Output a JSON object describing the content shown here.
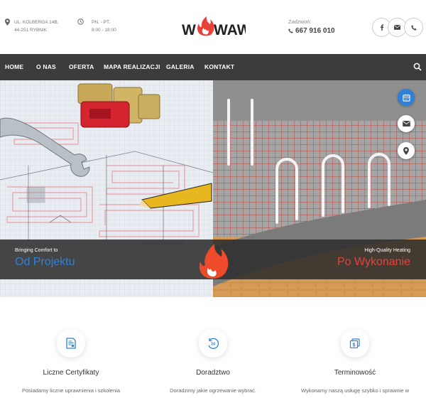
{
  "header": {
    "address_line1": "UL. KOLBERGA 14B,",
    "address_line2": "44-251 RYBNIK",
    "hours_line1": "PN. - PT.",
    "hours_line2": "8:00 - 18:00",
    "logo_text": "WAWRA",
    "call_label": "Zadzwoń:",
    "phone": "667 916 010",
    "social": [
      "facebook-icon",
      "mail-icon",
      "phone-icon"
    ]
  },
  "nav": {
    "items": [
      "HOME",
      "O NAS",
      "OFERTA",
      "MAPA REALIZACJI",
      "GALERIA",
      "KONTAKT"
    ]
  },
  "hero": {
    "left_small": "Bringing Comfort to",
    "left_big": "Od Projektu",
    "right_small": "High-Quality Heating",
    "right_big": "Po Wykonanie"
  },
  "floating": [
    "calendar-icon",
    "mail-icon",
    "location-pin-icon"
  ],
  "features": [
    {
      "title": "Liczne Certyfikaty",
      "desc": "Posiadamy liczne uprawnienia i szkolenia",
      "icon": "certificate-icon"
    },
    {
      "title": "Doradztwo",
      "desc": "Doradzimy jakie ogrzewanie wybrać.",
      "icon": "support-24-icon"
    },
    {
      "title": "Terminowość",
      "desc": "Wykonamy naszą usługę szybko i sprawnie w",
      "icon": "money-icon"
    }
  ],
  "colors": {
    "accent_blue": "#2f80d9",
    "accent_red": "#e8403a",
    "nav_bg": "#3c3c3c"
  }
}
